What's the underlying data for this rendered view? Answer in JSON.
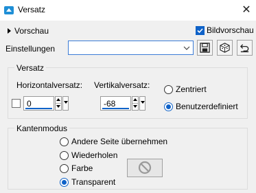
{
  "window": {
    "title": "Versatz",
    "close_icon": "close-icon"
  },
  "top": {
    "preview_label": "Vorschau",
    "bildvorschau_label": "Bildvorschau",
    "bildvorschau_checked": true
  },
  "settings": {
    "label": "Einstellungen",
    "combo_value": "",
    "icons": [
      "save-icon",
      "dice-icon",
      "reset-icon"
    ]
  },
  "offset": {
    "group_label": "Versatz",
    "horizontal": {
      "label": "Horizontalversatz:",
      "value": "0"
    },
    "vertical": {
      "label": "Vertikalversatz:",
      "value": "-68"
    },
    "radios": [
      {
        "label": "Zentriert",
        "checked": false
      },
      {
        "label": "Benutzerdefiniert",
        "checked": true
      }
    ]
  },
  "edge_mode": {
    "group_label": "Kantenmodus",
    "options": [
      {
        "label": "Andere Seite übernehmen",
        "checked": false
      },
      {
        "label": "Wiederholen",
        "checked": false
      },
      {
        "label": "Farbe",
        "checked": false
      },
      {
        "label": "Transparent",
        "checked": true
      }
    ],
    "color_swatch_icon": "no-color-icon"
  },
  "colors": {
    "accent": "#0f62c8",
    "background": "#f0f0f0",
    "titlebar": "#ffffff"
  }
}
